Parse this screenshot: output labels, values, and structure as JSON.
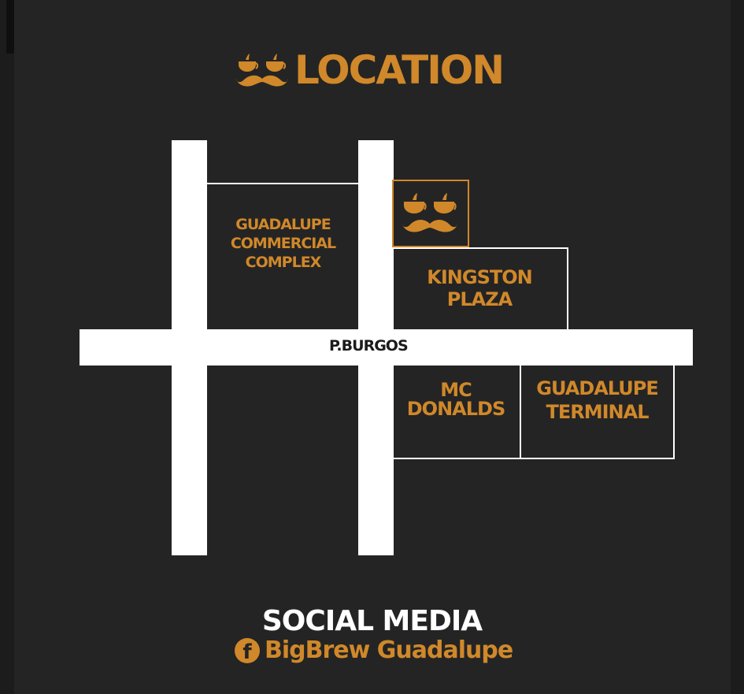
{
  "title": {
    "text": "LOCATION",
    "icon": "coffee-mustache-logo-icon"
  },
  "map": {
    "street_label": "P.BURGOS",
    "landmarks": [
      {
        "id": "guadalupe-commercial-complex",
        "label": "GUADALUPE\nCOMMERCIAL\nCOMPLEX"
      },
      {
        "id": "kingston-plaza",
        "label": "KINGSTON\nPLAZA"
      },
      {
        "id": "mc-donalds",
        "label": "MC\nDONALDS"
      },
      {
        "id": "guadalupe-terminal",
        "label": "GUADALUPE\nTERMINAL"
      }
    ],
    "shop_marker_icon": "coffee-mustache-logo-icon"
  },
  "social": {
    "heading": "SOCIAL MEDIA",
    "icon": "facebook-icon",
    "handle": "BigBrew Guadalupe"
  },
  "colors": {
    "accent": "#d0882a",
    "background": "#242424",
    "road": "#ffffff"
  }
}
